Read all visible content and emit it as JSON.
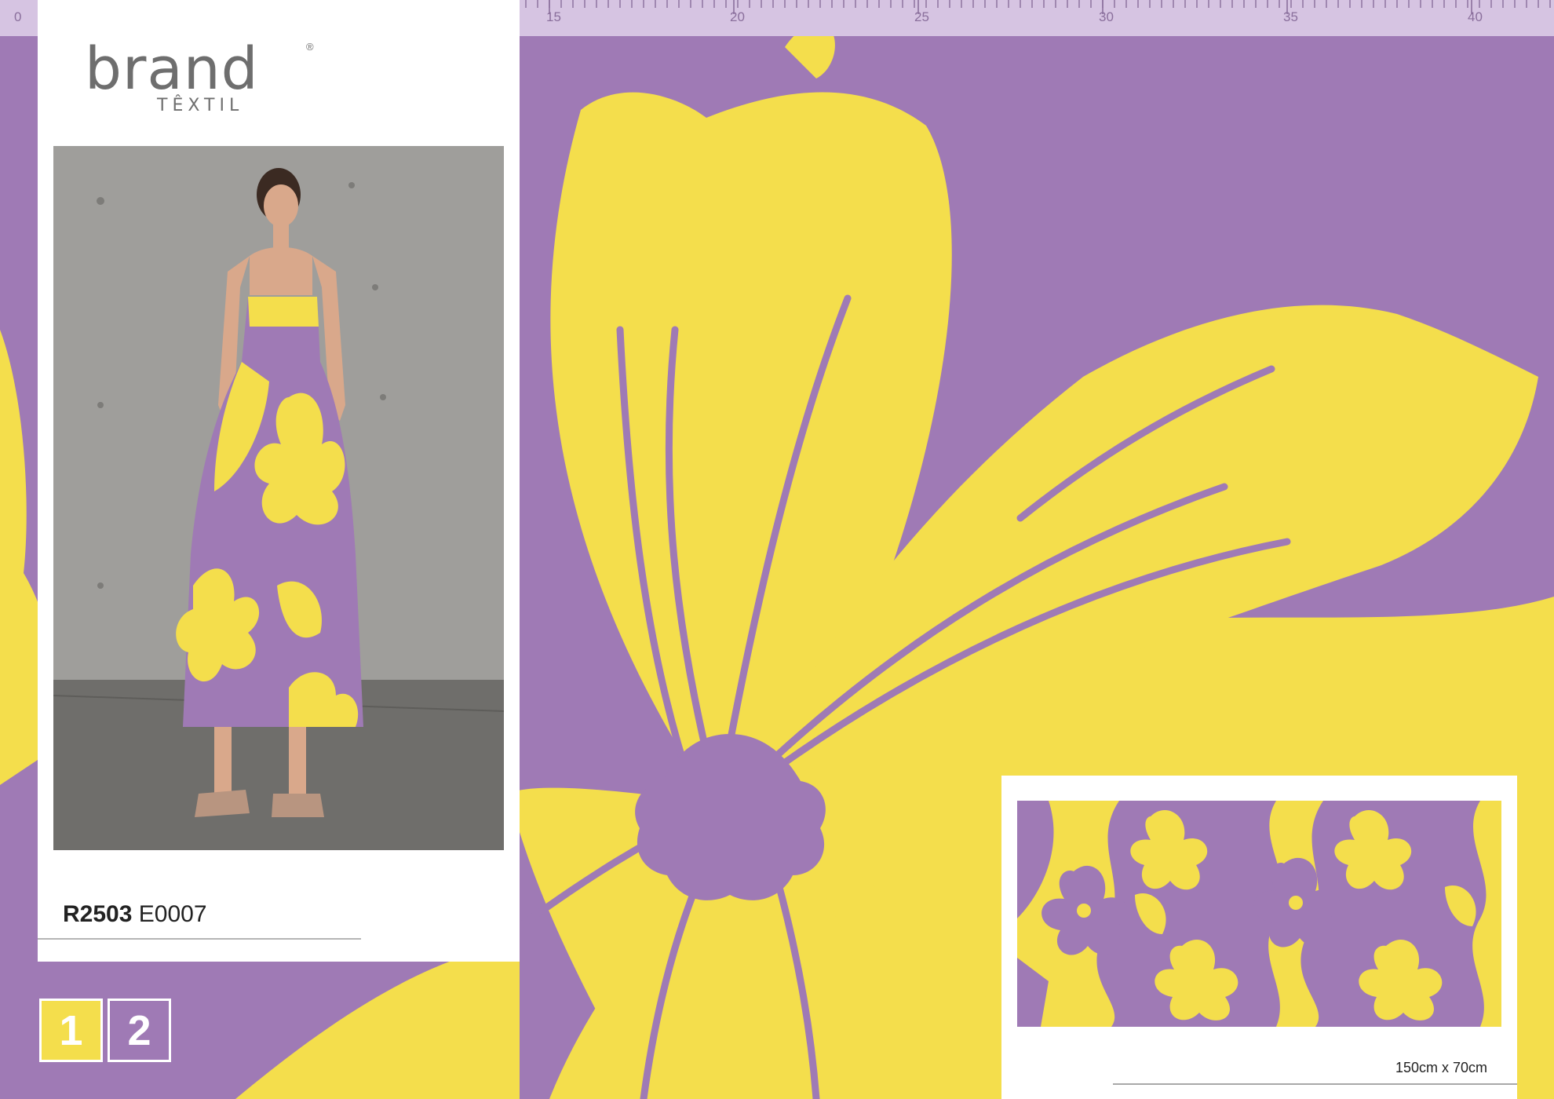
{
  "brand": {
    "name": "brand",
    "subtitle": "TÊXTIL",
    "registered": "®"
  },
  "ruler": {
    "labels": [
      "0",
      "15",
      "20",
      "25",
      "30",
      "35",
      "40"
    ]
  },
  "product": {
    "ref": "R2503",
    "code": "E0007"
  },
  "pages": [
    "1",
    "2"
  ],
  "swatch": {
    "size_label": "150cm x 70cm"
  },
  "colors": {
    "yellow": "#f4de4c",
    "purple": "#9f7ab5",
    "ruler": "#d6c4e2",
    "panel": "#ffffff"
  }
}
